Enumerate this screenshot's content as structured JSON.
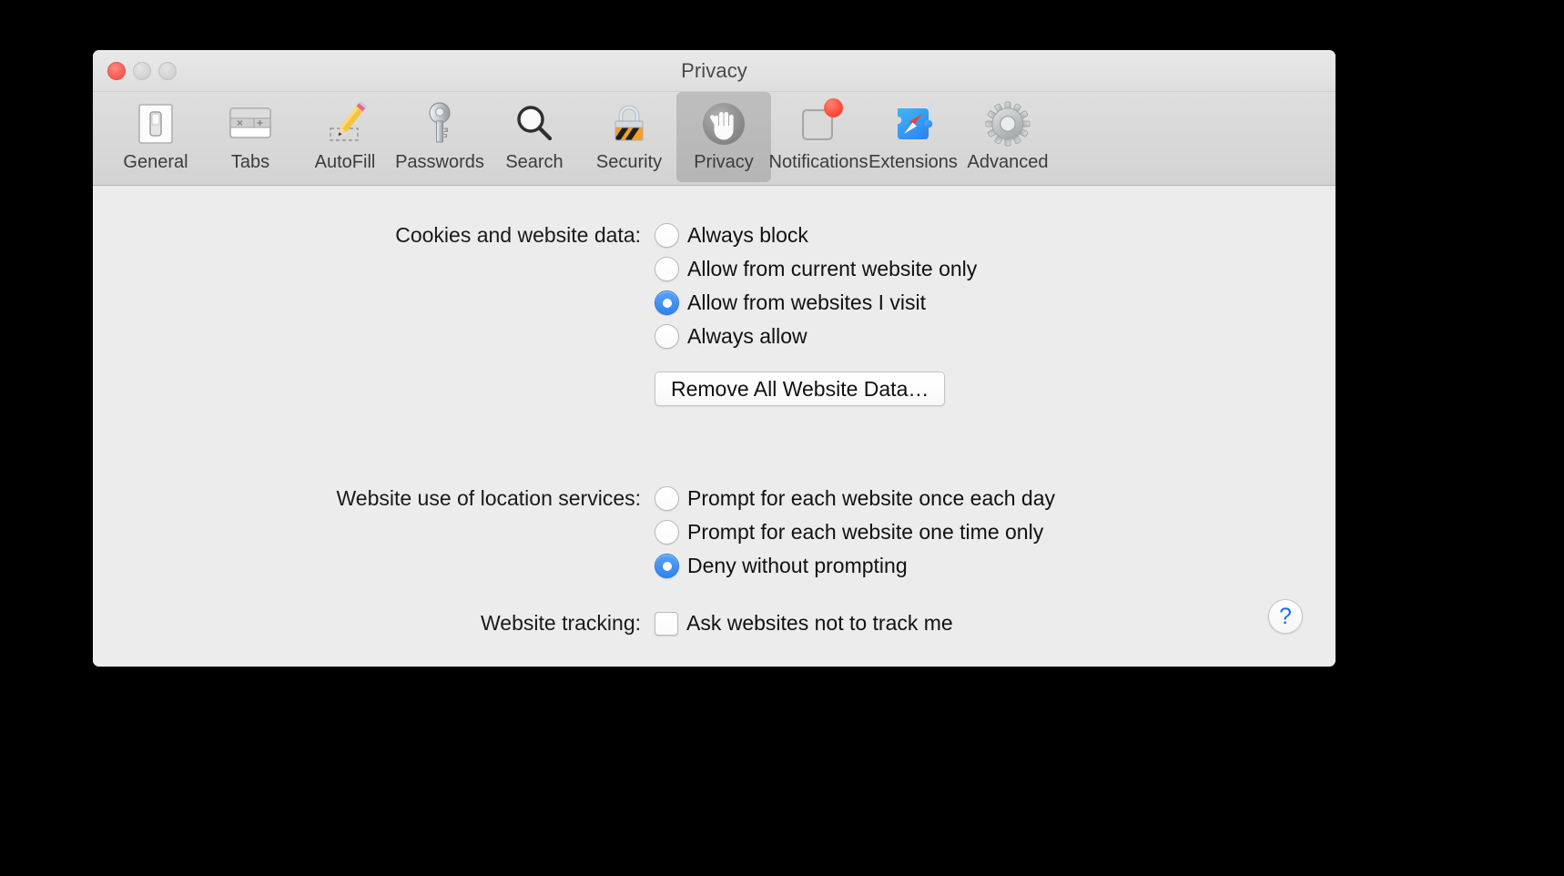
{
  "window": {
    "title": "Privacy",
    "controls": [
      {
        "name": "close",
        "enabled": true
      },
      {
        "name": "minimize",
        "enabled": false
      },
      {
        "name": "zoom",
        "enabled": false
      }
    ]
  },
  "toolbar": {
    "items": [
      {
        "label": "General",
        "icon": "general-switch-icon",
        "selected": false
      },
      {
        "label": "Tabs",
        "icon": "tabs-icon",
        "selected": false
      },
      {
        "label": "AutoFill",
        "icon": "pencil-autofill-icon",
        "selected": false
      },
      {
        "label": "Passwords",
        "icon": "key-icon",
        "selected": false
      },
      {
        "label": "Search",
        "icon": "magnifier-icon",
        "selected": false
      },
      {
        "label": "Security",
        "icon": "padlock-icon",
        "selected": false
      },
      {
        "label": "Privacy",
        "icon": "hand-stop-icon",
        "selected": true
      },
      {
        "label": "Notifications",
        "icon": "notification-badge-icon",
        "selected": false
      },
      {
        "label": "Extensions",
        "icon": "puzzle-compass-icon",
        "selected": false
      },
      {
        "label": "Advanced",
        "icon": "gear-icon",
        "selected": false
      }
    ]
  },
  "content": {
    "cookies": {
      "label": "Cookies and website data:",
      "options": [
        {
          "text": "Always block",
          "selected": false
        },
        {
          "text": "Allow from current website only",
          "selected": false
        },
        {
          "text": "Allow from websites I visit",
          "selected": true
        },
        {
          "text": "Always allow",
          "selected": false
        }
      ],
      "remove_button": "Remove All Website Data…"
    },
    "location": {
      "label": "Website use of location services:",
      "options": [
        {
          "text": "Prompt for each website once each day",
          "selected": false
        },
        {
          "text": "Prompt for each website one time only",
          "selected": false
        },
        {
          "text": "Deny without prompting",
          "selected": true
        }
      ]
    },
    "tracking": {
      "label": "Website tracking:",
      "checkbox_label": "Ask websites not to track me",
      "checked": false
    },
    "help_button": "?"
  },
  "colors": {
    "accent_blue": "#3b8aee",
    "help_blue": "#1273e8",
    "close_red": "#fb6158",
    "window_bg": "#ececec",
    "toolbar_bg": "#d8d8d8"
  }
}
